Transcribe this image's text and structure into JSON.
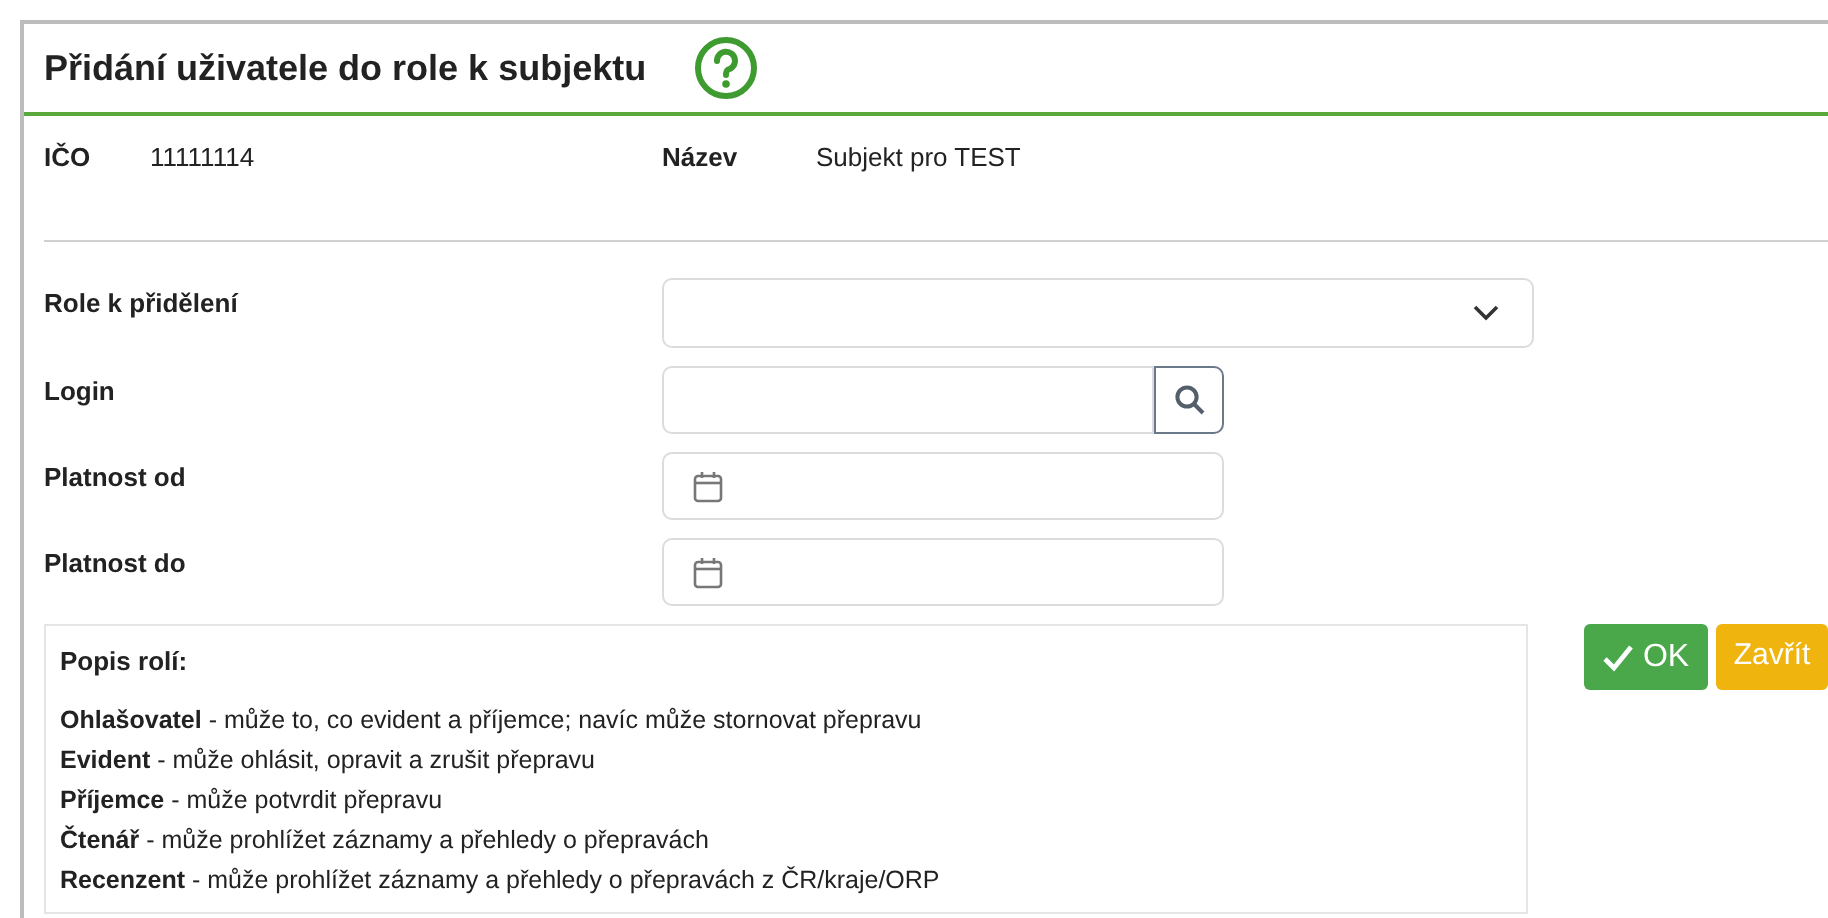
{
  "dialog": {
    "title": "Přidání uživatele do role k subjektu"
  },
  "subject": {
    "ico_label": "IČO",
    "ico": "11111114",
    "name_label": "Název",
    "name": "Subjekt pro TEST"
  },
  "fields": [
    {
      "label": "Role k přidělení",
      "kind": "select"
    },
    {
      "label": "Login",
      "kind": "search"
    },
    {
      "label": "Platnost od",
      "kind": "date"
    },
    {
      "label": "Platnost do",
      "kind": "date"
    }
  ],
  "roles_help": {
    "title": "Popis rolí:",
    "roles": [
      {
        "name": "Ohlašovatel",
        "description": " - může to, co evident a příjemce; navíc může stornovat přepravu"
      },
      {
        "name": "Evident",
        "description": " - může ohlásit, opravit a zrušit přepravu"
      },
      {
        "name": "Příjemce",
        "description": " - může potvrdit přepravu"
      },
      {
        "name": "Čtenář",
        "description": " - může prohlížet záznamy a přehledy o přepravách"
      },
      {
        "name": "Recenzent",
        "description": " - může prohlížet záznamy a přehledy o přepravách z ČR/kraje/ORP"
      }
    ]
  },
  "buttons": {
    "ok": "OK",
    "close": "Zavřít"
  }
}
